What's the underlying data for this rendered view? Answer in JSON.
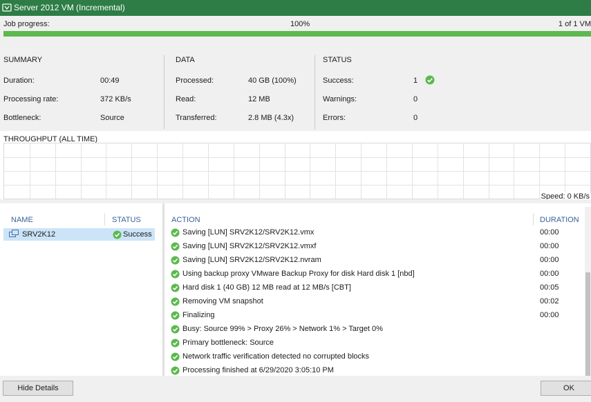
{
  "window": {
    "title": "Server 2012 VM (Incremental)"
  },
  "progress": {
    "label": "Job progress:",
    "percent_text": "100%",
    "count_text": "1 of 1 VM",
    "fraction": 1.0
  },
  "summary": {
    "header": "SUMMARY",
    "rows": [
      {
        "label": "Duration:",
        "value": "00:49"
      },
      {
        "label": "Processing rate:",
        "value": "372 KB/s"
      },
      {
        "label": "Bottleneck:",
        "value": "Source"
      }
    ]
  },
  "data_section": {
    "header": "DATA",
    "rows": [
      {
        "label": "Processed:",
        "value": "40 GB (100%)"
      },
      {
        "label": "Read:",
        "value": "12 MB"
      },
      {
        "label": "Transferred:",
        "value": "2.8 MB (4.3x)"
      }
    ]
  },
  "status_section": {
    "header": "STATUS",
    "rows": [
      {
        "label": "Success:",
        "value": "1"
      },
      {
        "label": "Warnings:",
        "value": "0"
      },
      {
        "label": "Errors:",
        "value": "0"
      }
    ]
  },
  "throughput": {
    "label": "THROUGHPUT (ALL TIME)",
    "speed": "Speed: 0 KB/s"
  },
  "vm_list": {
    "headers": {
      "name": "NAME",
      "status": "STATUS"
    },
    "items": [
      {
        "name": "SRV2K12",
        "status": "Success"
      }
    ]
  },
  "log": {
    "headers": {
      "action": "ACTION",
      "duration": "DURATION"
    },
    "rows": [
      {
        "action": "Saving [LUN] SRV2K12/SRV2K12.vmx",
        "duration": "00:00"
      },
      {
        "action": "Saving [LUN] SRV2K12/SRV2K12.vmxf",
        "duration": "00:00"
      },
      {
        "action": "Saving [LUN] SRV2K12/SRV2K12.nvram",
        "duration": "00:00"
      },
      {
        "action": "Using backup proxy VMware Backup Proxy for disk Hard disk 1 [nbd]",
        "duration": "00:00"
      },
      {
        "action": "Hard disk 1 (40 GB) 12 MB read at 12 MB/s [CBT]",
        "duration": "00:05"
      },
      {
        "action": "Removing VM snapshot",
        "duration": "00:02"
      },
      {
        "action": "Finalizing",
        "duration": "00:00"
      },
      {
        "action": "Busy: Source 99% > Proxy 26% > Network 1% > Target 0%",
        "duration": ""
      },
      {
        "action": "Primary bottleneck: Source",
        "duration": ""
      },
      {
        "action": "Network traffic verification detected no corrupted blocks",
        "duration": ""
      },
      {
        "action": "Processing finished at 6/29/2020 3:05:10 PM",
        "duration": ""
      }
    ]
  },
  "footer": {
    "hide_details": "Hide Details",
    "ok": "OK"
  },
  "colors": {
    "titlebar": "#2e7d46",
    "progress": "#5cb94e",
    "success": "#5cb94e",
    "selection": "#cce4f7",
    "header_text": "#3a5f9a"
  }
}
